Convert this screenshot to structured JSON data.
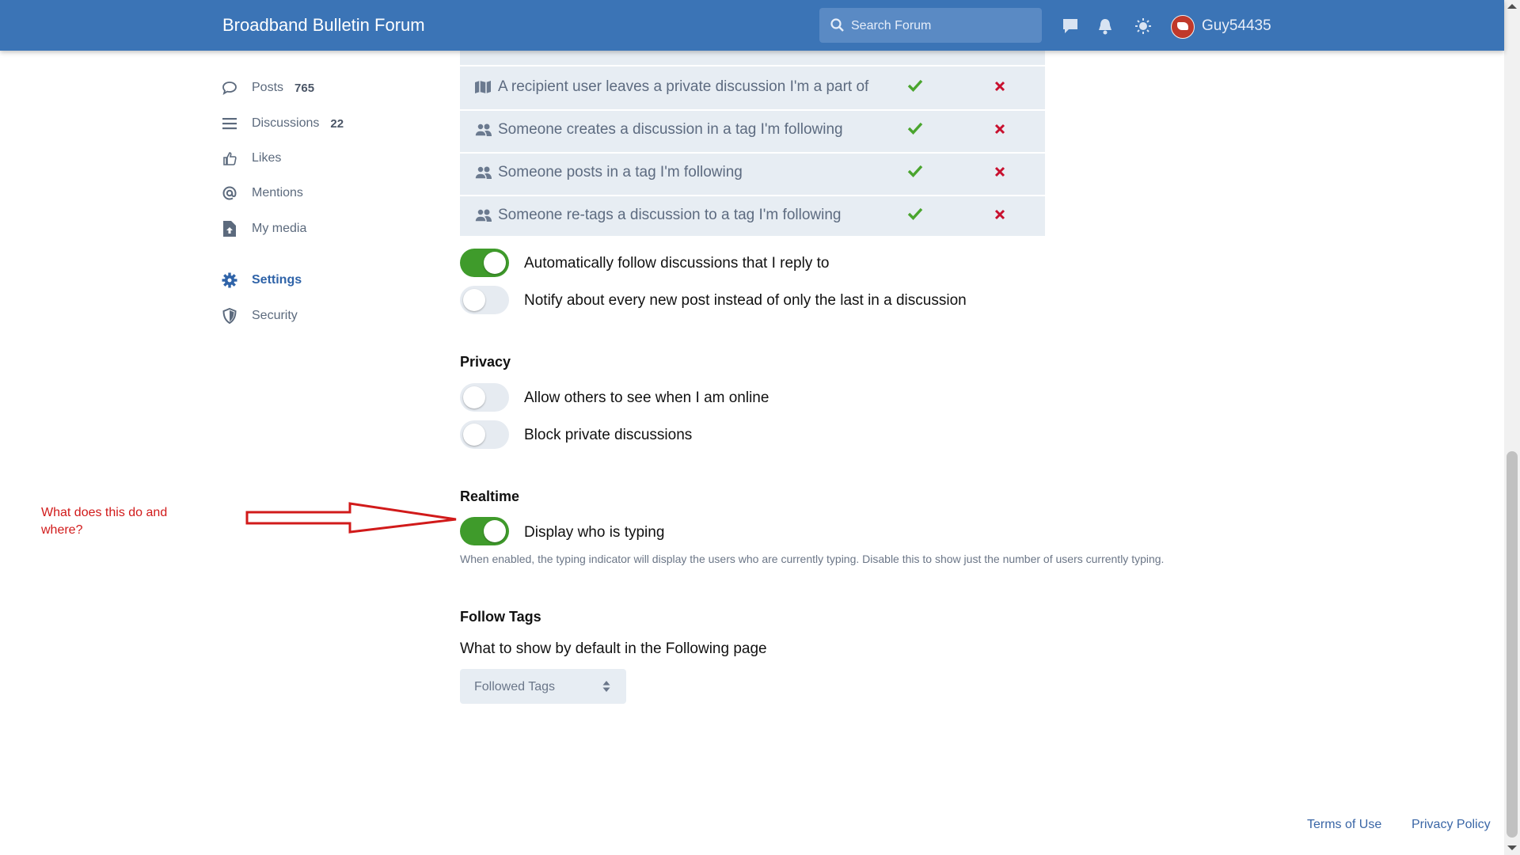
{
  "header": {
    "brand": "Broadband Bulletin Forum",
    "search_placeholder": "Search Forum",
    "username": "Guy54435"
  },
  "sidebar": {
    "items": [
      {
        "label": "Posts",
        "count": "765",
        "icon": "comment-icon"
      },
      {
        "label": "Discussions",
        "count": "22",
        "icon": "list-icon"
      },
      {
        "label": "Likes",
        "icon": "thumbs-up-icon"
      },
      {
        "label": "Mentions",
        "icon": "at-icon"
      },
      {
        "label": "My media",
        "icon": "file-upload-icon"
      },
      {
        "label": "Settings",
        "icon": "gear-icon",
        "active": true
      },
      {
        "label": "Security",
        "icon": "shield-icon"
      }
    ]
  },
  "notifications": {
    "rows": [
      {
        "label": "A recipient user leaves a private discussion I'm a part of",
        "icon": "map-icon",
        "alert": true,
        "email": false
      },
      {
        "label": "Someone creates a discussion in a tag I'm following",
        "icon": "user-group-icon",
        "alert": true,
        "email": false
      },
      {
        "label": "Someone posts in a tag I'm following",
        "icon": "user-group-icon",
        "alert": true,
        "email": false
      },
      {
        "label": "Someone re-tags a discussion to a tag I'm following",
        "icon": "user-group-icon",
        "alert": true,
        "email": false
      }
    ],
    "toggles": [
      {
        "label": "Automatically follow discussions that I reply to",
        "on": true
      },
      {
        "label": "Notify about every new post instead of only the last in a discussion",
        "on": false
      }
    ]
  },
  "privacy": {
    "title": "Privacy",
    "toggles": [
      {
        "label": "Allow others to see when I am online",
        "on": false
      },
      {
        "label": "Block private discussions",
        "on": false
      }
    ]
  },
  "realtime": {
    "title": "Realtime",
    "toggle_label": "Display who is typing",
    "on": true,
    "help": "When enabled, the typing indicator will display the users who are currently typing. Disable this to show just the number of users currently typing."
  },
  "follow_tags": {
    "title": "Follow Tags",
    "description": "What to show by default in the Following page",
    "selected": "Followed Tags"
  },
  "annotation": {
    "text": "What does this do and where?"
  },
  "footer": {
    "terms": "Terms of Use",
    "privacy": "Privacy Policy"
  },
  "colors": {
    "header": "#3b74b6",
    "toggle_on": "#3f9b2b",
    "check": "#4aa52e",
    "cross": "#c8102e",
    "annotation": "#d11a1a"
  }
}
